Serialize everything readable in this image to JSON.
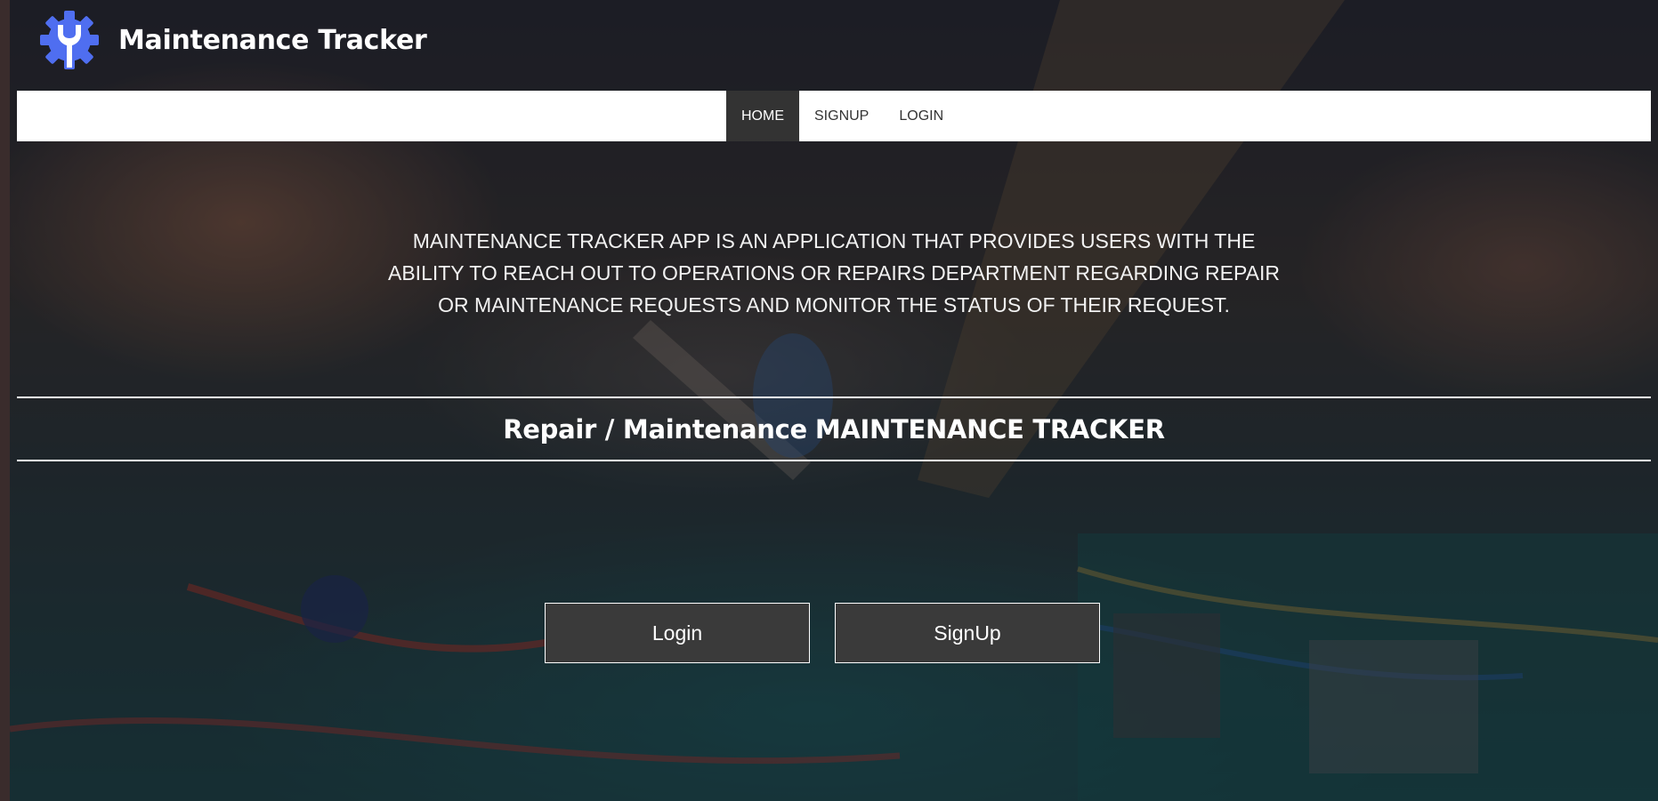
{
  "brand": {
    "name": "Maintenance Tracker",
    "logo_icon": "wrench-gear-icon",
    "logo_color": "#4f6ef0"
  },
  "nav": {
    "items": [
      {
        "label": "HOME",
        "active": true
      },
      {
        "label": "SIGNUP",
        "active": false
      },
      {
        "label": "LOGIN",
        "active": false
      }
    ]
  },
  "hero": {
    "intro": "MAINTENANCE TRACKER APP IS AN APPLICATION THAT PROVIDES USERS WITH THE ABILITY TO REACH OUT TO OPERATIONS OR REPAIRS DEPARTMENT REGARDING REPAIR OR MAINTENANCE REQUESTS AND MONITOR THE STATUS OF THEIR REQUEST.",
    "heading_prefix": "Repair / Maintenance",
    "heading_accent": "MAINTENANCE TRACKER"
  },
  "actions": {
    "login_label": "Login",
    "signup_label": "SignUp"
  },
  "colors": {
    "navbar_bg": "#ffffff",
    "nav_active_bg": "#333333",
    "button_bg": "#3a3a3a"
  }
}
